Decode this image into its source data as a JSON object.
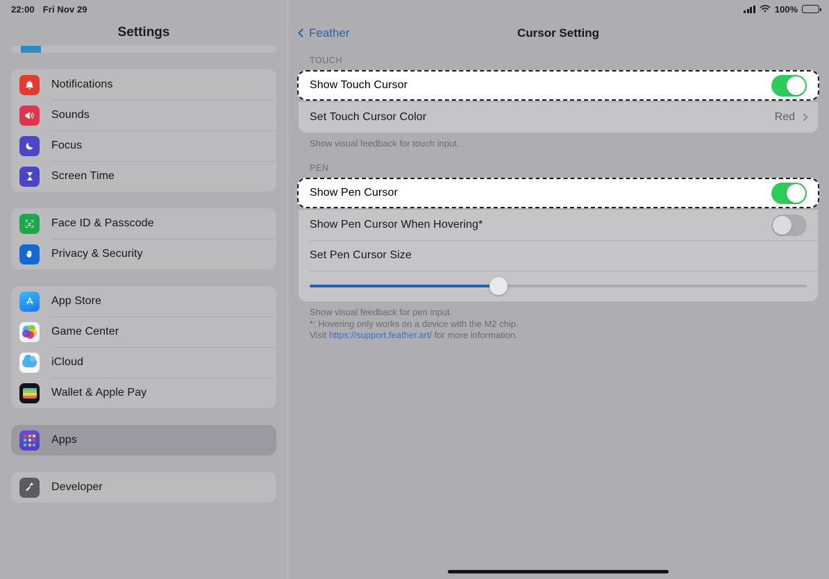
{
  "status_bar": {
    "time": "22:00",
    "date": "Fri Nov 29",
    "battery_percent": "100%",
    "cellular_icon": "cellular-bars-icon",
    "wifi_icon": "wifi-icon",
    "battery_icon": "battery-full-icon"
  },
  "sidebar": {
    "title": "Settings",
    "groups": [
      {
        "items": []
      },
      {
        "items": [
          {
            "label": "Notifications",
            "icon": "notifications-icon",
            "icon_class": "ic-notif",
            "glyph": "🔔"
          },
          {
            "label": "Sounds",
            "icon": "sounds-icon",
            "icon_class": "ic-sounds",
            "glyph": "🔊"
          },
          {
            "label": "Focus",
            "icon": "focus-icon",
            "icon_class": "ic-focus",
            "glyph": "🌙"
          },
          {
            "label": "Screen Time",
            "icon": "screen-time-icon",
            "icon_class": "ic-screentime",
            "glyph": "⌛"
          }
        ]
      },
      {
        "items": [
          {
            "label": "Face ID & Passcode",
            "icon": "face-id-icon",
            "icon_class": "ic-faceid",
            "glyph": "☺"
          },
          {
            "label": "Privacy & Security",
            "icon": "privacy-hand-icon",
            "icon_class": "ic-privacy",
            "glyph": "✋"
          }
        ]
      },
      {
        "items": [
          {
            "label": "App Store",
            "icon": "app-store-icon",
            "icon_class": "ic-appstore",
            "glyph": "A"
          },
          {
            "label": "Game Center",
            "icon": "game-center-icon",
            "icon_class": "ic-gamecenter",
            "glyph": ""
          },
          {
            "label": "iCloud",
            "icon": "icloud-icon",
            "icon_class": "ic-icloud",
            "glyph": ""
          },
          {
            "label": "Wallet & Apple Pay",
            "icon": "wallet-icon",
            "icon_class": "ic-wallet",
            "glyph": ""
          }
        ]
      },
      {
        "items": [
          {
            "label": "Apps",
            "icon": "apps-icon",
            "icon_class": "ic-apps",
            "glyph": "",
            "selected": true
          }
        ]
      },
      {
        "items": [
          {
            "label": "Developer",
            "icon": "developer-hammer-icon",
            "icon_class": "ic-developer",
            "glyph": "🔨"
          }
        ]
      }
    ]
  },
  "nav": {
    "back_label": "Feather",
    "back_icon": "chevron-left-icon",
    "title": "Cursor Setting"
  },
  "touch_section": {
    "header": "TOUCH",
    "show_touch_cursor": {
      "label": "Show Touch Cursor",
      "toggle_state": "on",
      "highlighted": true
    },
    "set_touch_cursor_color": {
      "label": "Set Touch Cursor Color",
      "value": "Red",
      "disclosure_icon": "chevron-right-icon"
    },
    "footnote": "Show visual feedback for touch input."
  },
  "pen_section": {
    "header": "PEN",
    "show_pen_cursor": {
      "label": "Show Pen Cursor",
      "toggle_state": "on",
      "highlighted": true
    },
    "show_pen_cursor_hovering": {
      "label": "Show Pen Cursor When Hovering*",
      "toggle_state": "off"
    },
    "set_pen_cursor_size": {
      "label": "Set Pen Cursor Size",
      "slider_percent": 38
    },
    "footnote_line1": "Show visual feedback for pen input.",
    "footnote_line2": "*: Hovering only works on a device with the M2 chip.",
    "footnote_line3_prefix": "Visit ",
    "footnote_link": "https://support.feather.art/",
    "footnote_line3_suffix": " for more information."
  },
  "colors": {
    "toggle_on": "#2ecc56",
    "slider_fill": "#1c62bd",
    "link": "#3a6fc0",
    "accent_back": "#2b5fa8",
    "highlight_border": "#1a1a1a"
  }
}
